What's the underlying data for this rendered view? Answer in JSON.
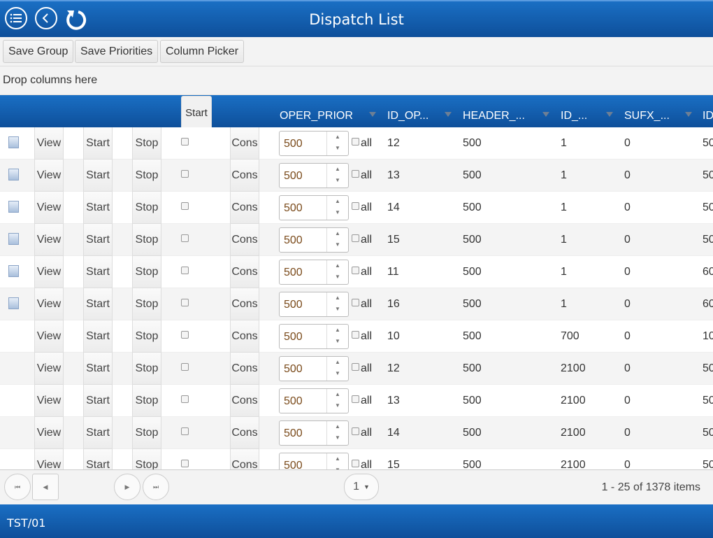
{
  "header": {
    "title": "Dispatch List",
    "icons": [
      "menu-icon",
      "back-icon",
      "refresh-icon"
    ]
  },
  "toolbar": {
    "save_group": "Save Group",
    "save_priorities": "Save Priorities",
    "column_picker": "Column Picker"
  },
  "group_bar": {
    "placeholder": "Drop columns here"
  },
  "columns": {
    "start": "Start",
    "oper_prior": "OPER_PRIOR",
    "id_op": "ID_OP...",
    "header": "HEADER_...",
    "id": "ID_...",
    "sufx": "SUFX_...",
    "last": "ID"
  },
  "row_labels": {
    "view": "View",
    "start": "Start",
    "stop": "Stop",
    "cons": "Cons",
    "all": "all"
  },
  "rows": [
    {
      "doc": true,
      "prior": "500",
      "id_op": "12",
      "header": "500",
      "id": "1",
      "sufx": "0",
      "last": "50"
    },
    {
      "doc": true,
      "prior": "500",
      "id_op": "13",
      "header": "500",
      "id": "1",
      "sufx": "0",
      "last": "50"
    },
    {
      "doc": true,
      "prior": "500",
      "id_op": "14",
      "header": "500",
      "id": "1",
      "sufx": "0",
      "last": "50"
    },
    {
      "doc": true,
      "prior": "500",
      "id_op": "15",
      "header": "500",
      "id": "1",
      "sufx": "0",
      "last": "50"
    },
    {
      "doc": true,
      "prior": "500",
      "id_op": "11",
      "header": "500",
      "id": "1",
      "sufx": "0",
      "last": "60"
    },
    {
      "doc": true,
      "prior": "500",
      "id_op": "16",
      "header": "500",
      "id": "1",
      "sufx": "0",
      "last": "60"
    },
    {
      "doc": false,
      "prior": "500",
      "id_op": "10",
      "header": "500",
      "id": "700",
      "sufx": "0",
      "last": "10"
    },
    {
      "doc": false,
      "prior": "500",
      "id_op": "12",
      "header": "500",
      "id": "2100",
      "sufx": "0",
      "last": "50"
    },
    {
      "doc": false,
      "prior": "500",
      "id_op": "13",
      "header": "500",
      "id": "2100",
      "sufx": "0",
      "last": "50"
    },
    {
      "doc": false,
      "prior": "500",
      "id_op": "14",
      "header": "500",
      "id": "2100",
      "sufx": "0",
      "last": "50"
    },
    {
      "doc": false,
      "prior": "500",
      "id_op": "15",
      "header": "500",
      "id": "2100",
      "sufx": "0",
      "last": "50"
    }
  ],
  "pager": {
    "page": "1",
    "info": "1 - 25 of 1378 items"
  },
  "footer": {
    "text": "TST/01"
  }
}
